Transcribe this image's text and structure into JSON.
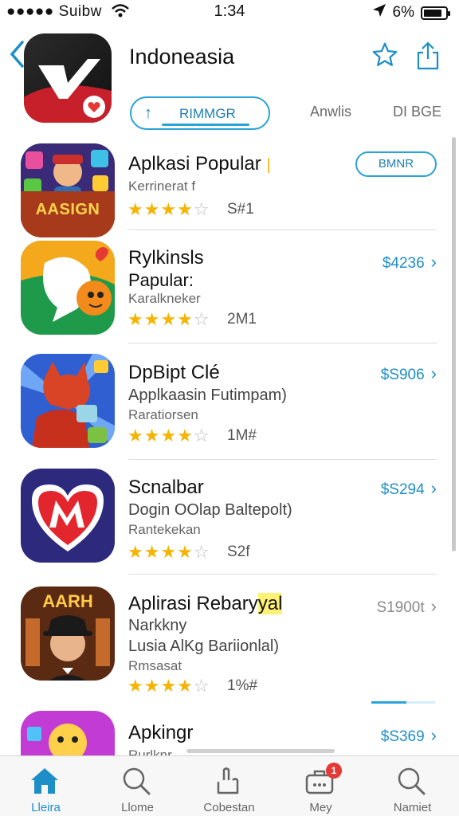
{
  "status_bar": {
    "carrier": "●●●●● Suibw",
    "time": "1:34",
    "battery": "6%",
    "battery_level": 0.85
  },
  "header": {
    "title": "Indoneasia",
    "tabs": [
      "RIMMGR",
      "Anwlis",
      "DI BGE"
    ]
  },
  "apps": [
    {
      "name": "Aplkasi Popular",
      "subtitle": "",
      "category": "Kerrinerat f",
      "rating_filled": 4,
      "rating_total": 5,
      "count": "S#1",
      "action": "BMNR",
      "icon_text": "AASIGN"
    },
    {
      "name": "Rylkinsls",
      "subtitle": "Papular:",
      "category": "Karalkneker",
      "rating_filled": 4,
      "rating_total": 5,
      "count": "2M1",
      "price": "$4236"
    },
    {
      "name": "DpBipt Clé",
      "subtitle": "Applkaasin Futimpam)",
      "category": "Raratiorsen",
      "rating_filled": 4,
      "rating_total": 5,
      "count": "1M#",
      "price": "$S906"
    },
    {
      "name": "Scnalbar",
      "subtitle": "Dogin OOlap Baltepolt)",
      "category": "Rantekekan",
      "rating_filled": 4,
      "rating_total": 5,
      "count": "S2f",
      "price": "$S294"
    },
    {
      "name": "Aplirasi Rebary",
      "name_highlight": "yal",
      "subtitle": "Narkkny",
      "subtitle2": "Lusia AlKg Bariionlal)",
      "category": "Rmsasat",
      "rating_filled": 4,
      "rating_total": 5,
      "count": "1%#",
      "price": "S1900t",
      "download_progress": 0.55,
      "icon_text": "AARH"
    },
    {
      "name": "Apkingr",
      "category": "Rurlknr",
      "price": "$S369"
    }
  ],
  "tab_bar": [
    {
      "label": "Lleira",
      "icon": "home-icon",
      "active": true
    },
    {
      "label": "Llome",
      "icon": "search-icon"
    },
    {
      "label": "Cobestan",
      "icon": "hand-icon"
    },
    {
      "label": "Mey",
      "icon": "briefcase-icon",
      "badge": "1"
    },
    {
      "label": "Namiet",
      "icon": "search-icon"
    }
  ],
  "colors": {
    "accent": "#1e8fc6",
    "star": "#f5b400",
    "badge": "#e53935"
  }
}
